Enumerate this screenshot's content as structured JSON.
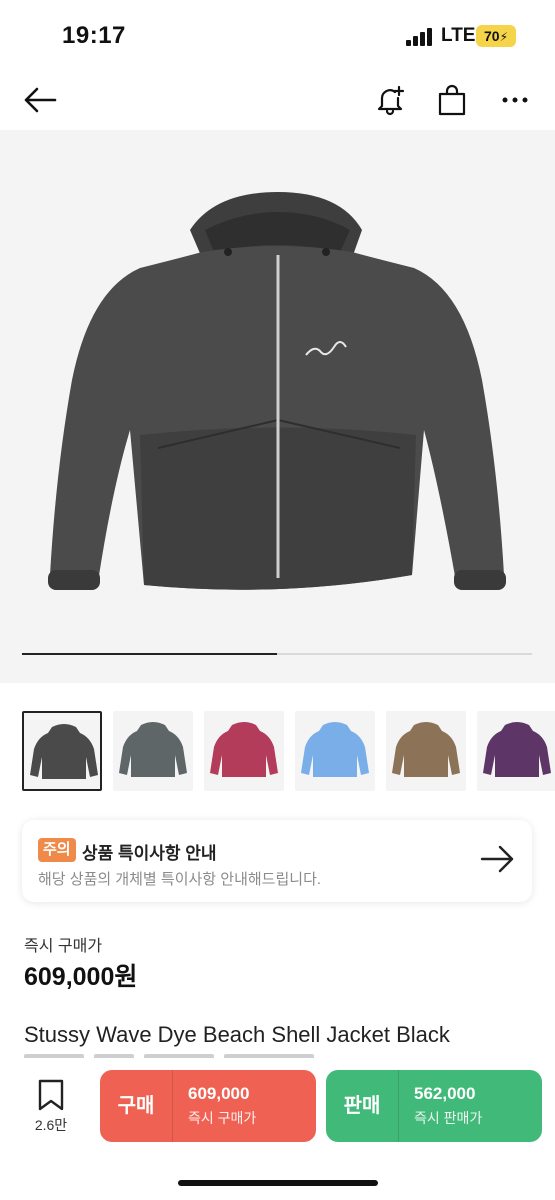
{
  "status_bar": {
    "time": "19:17",
    "network": "LTE",
    "battery": "70"
  },
  "header": {
    "back_icon": "arrow-left-icon",
    "icons": [
      "bell-plus-icon",
      "shopping-bag-icon",
      "more-horizontal-icon"
    ]
  },
  "gallery": {
    "progress": 0.5,
    "selected_index": 0,
    "thumbnails": [
      {
        "color": "#4a4a4a"
      },
      {
        "color": "#5e6668"
      },
      {
        "color": "#b23c5a"
      },
      {
        "color": "#7aaee8"
      },
      {
        "color": "#8c7256"
      },
      {
        "color": "#5d3566"
      }
    ]
  },
  "notice": {
    "badge": "주의",
    "title": "상품 특이사항 안내",
    "description": "해당 상품의 개체별 특이사항 안내해드립니다."
  },
  "price": {
    "label": "즉시 구매가",
    "value": "609,000원"
  },
  "product": {
    "name": "Stussy Wave Dye Beach Shell Jacket Black"
  },
  "bottom_bar": {
    "wish_count": "2.6만",
    "buy": {
      "label": "구매",
      "price": "609,000",
      "sub": "즉시 구매가"
    },
    "sell": {
      "label": "판매",
      "price": "562,000",
      "sub": "즉시 판매가"
    }
  },
  "colors": {
    "buy": "#ef6253",
    "sell": "#41b979",
    "badge": "#ef8a4a",
    "battery": "#f5d44a"
  }
}
